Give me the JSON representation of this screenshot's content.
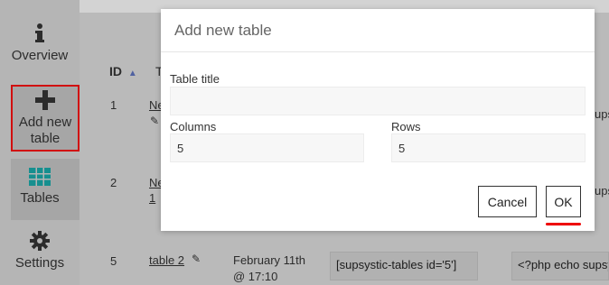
{
  "sidebar": {
    "items": [
      {
        "label": "Overview",
        "icon": "info-icon"
      },
      {
        "label_line1": "Add new",
        "label_line2": "table",
        "icon": "plus-icon"
      },
      {
        "label": "Tables",
        "icon": "table-grid-icon"
      },
      {
        "label": "Settings",
        "icon": "gear-icon"
      }
    ]
  },
  "table": {
    "header_id": "ID",
    "header_title": "T",
    "rows": [
      {
        "id": "1",
        "title": "Ne"
      },
      {
        "id": "2",
        "title": "Ne",
        "title2": "1"
      },
      {
        "id": "5",
        "title": "table 2",
        "date_line1": "February 11th",
        "date_line2": "@ 17:10",
        "shortcode": "[supsystic-tables id='5']",
        "php": "<?php echo supsy"
      }
    ],
    "right_clip_1": "upsy",
    "right_clip_2": "upsy"
  },
  "modal": {
    "title": "Add new table",
    "table_title_label": "Table title",
    "table_title_value": "",
    "columns_label": "Columns",
    "columns_value": "5",
    "rows_label": "Rows",
    "rows_value": "5",
    "cancel_label": "Cancel",
    "ok_label": "OK"
  },
  "colors": {
    "highlight_red": "#e11111",
    "tables_icon": "#1aa3a3"
  }
}
